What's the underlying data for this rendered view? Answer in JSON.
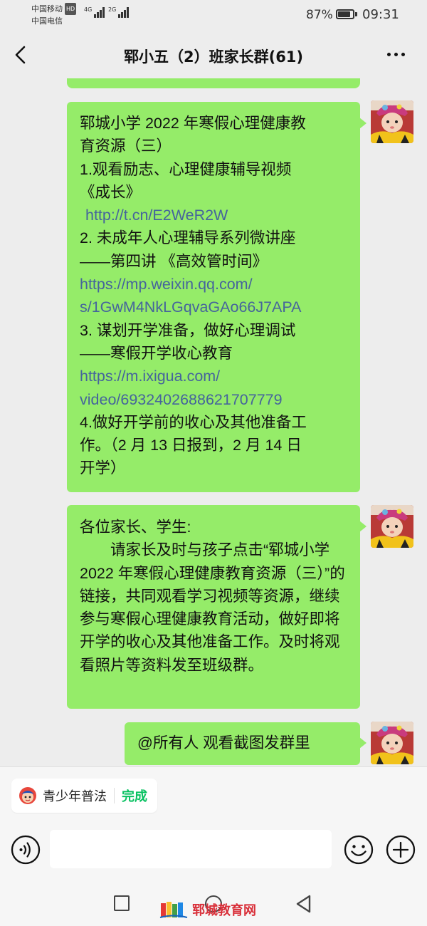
{
  "status_bar": {
    "carrier_1": "中国移动",
    "carrier_1_badge": "HD",
    "carrier_2": "中国电信",
    "signal_1_label": "4G",
    "signal_2_label": "2G",
    "battery_level": "87%",
    "battery_fraction": 0.87,
    "time": "09:31"
  },
  "header": {
    "title": "郓小五（2）班家长群(61)"
  },
  "messages": {
    "m1": {
      "lines": [
        "郓城小学 2022 年寒假心理健康教",
        "育资源（三）",
        "1.观看励志、心理健康辅导视频",
        "《成长》"
      ],
      "link_1": "http://t.cn/E2WeR2W",
      "lines_2": [
        "2. 未成年人心理辅导系列微讲座",
        "——第四讲 《高效管时间》"
      ],
      "link_2": [
        "https://mp.weixin.qq.com/",
        "s/1GwM4NkLGqvaGAo66J7APA"
      ],
      "lines_3": [
        "3. 谋划开学准备，做好心理调试",
        "——寒假开学收心教育"
      ],
      "link_3": [
        "https://m.ixigua.com/",
        "video/6932402688621707779"
      ],
      "lines_4": [
        "4.做好开学前的收心及其他准备工",
        "作。（2 月 13 日报到，2 月 14 日",
        "开学）"
      ]
    },
    "m2": {
      "greeting": "各位家长、学生:",
      "body": "请家长及时与孩子点击“郓城小学 2022 年寒假心理健康教育资源（三）”的链接，共同观看学习视频等资源，继续参与寒假心理健康教育活动，做好即将开学的收心及其他准备工作。及时将观看照片等资料发至班级群。"
    },
    "m3": {
      "text": "@所有人  观看截图发群里"
    }
  },
  "mini_program": {
    "name": "青少年普法",
    "action": "完成"
  },
  "input": {
    "value": ""
  },
  "watermark": {
    "text": "郓城教育网"
  },
  "colors": {
    "bubble": "#95ec69",
    "link": "#45649c",
    "accent_green": "#07c160",
    "background": "#ededed"
  },
  "icons": {
    "back": "chevron-left-icon",
    "more": "more-dots-icon",
    "voice": "voice-icon",
    "emoji": "emoji-icon",
    "plus": "plus-circle-icon",
    "nav_recent": "square-icon",
    "nav_home": "circle-icon",
    "nav_back": "triangle-back-icon"
  }
}
